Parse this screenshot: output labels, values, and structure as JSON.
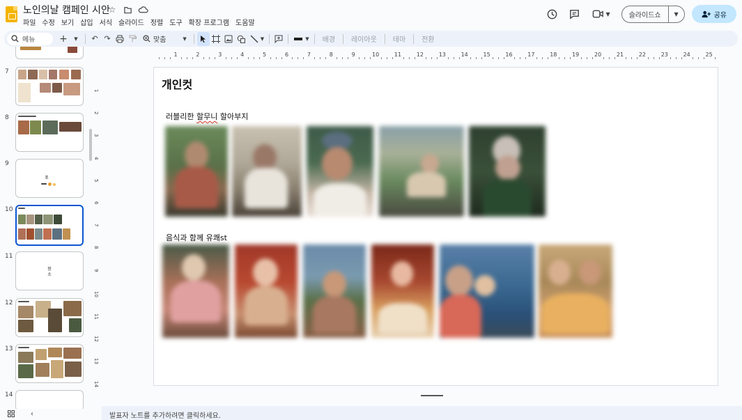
{
  "app": {
    "title": "노인의날 캠페인 시안",
    "menu": [
      "파일",
      "수정",
      "보기",
      "삽입",
      "서식",
      "슬라이드",
      "정렬",
      "도구",
      "확장 프로그램",
      "도움말"
    ],
    "slideshow_label": "슬라이드쇼",
    "share_label": "공유"
  },
  "toolbar": {
    "search_label": "메뉴",
    "zoom_label": "맞춤",
    "background_label": "배경",
    "layout_label": "레이아웃",
    "theme_label": "테마",
    "transition_label": "전환"
  },
  "filmstrip": {
    "slides": [
      {
        "number": "7"
      },
      {
        "number": "8"
      },
      {
        "number": "9",
        "text": "포"
      },
      {
        "number": "10"
      },
      {
        "number": "11",
        "text_line1": "장",
        "text_line2": "소"
      },
      {
        "number": "12"
      },
      {
        "number": "13"
      },
      {
        "number": "14"
      }
    ]
  },
  "ruler": {
    "top": [
      "1",
      "2",
      "3",
      "4",
      "5",
      "6",
      "7",
      "8",
      "9",
      "10",
      "11",
      "12",
      "13",
      "14",
      "15",
      "16",
      "17",
      "18",
      "19",
      "20",
      "21",
      "22",
      "23",
      "24",
      "25"
    ],
    "left": [
      "1",
      "2",
      "3",
      "4",
      "5",
      "6",
      "7",
      "8",
      "9",
      "10",
      "11",
      "12",
      "13",
      "14"
    ]
  },
  "slide": {
    "title": "개인컷",
    "section1_prefix": "러블리한 ",
    "section1_wavy": "할무니",
    "section1_suffix": " 할아부지",
    "section2": "음식과 함께 유쾌st"
  },
  "notes": {
    "placeholder": "발표자 노트를 추가하려면 클릭하세요."
  },
  "colors": {
    "accent": "#0b57d0",
    "share_bg": "#c2e7ff",
    "logo": "#f4b400"
  }
}
